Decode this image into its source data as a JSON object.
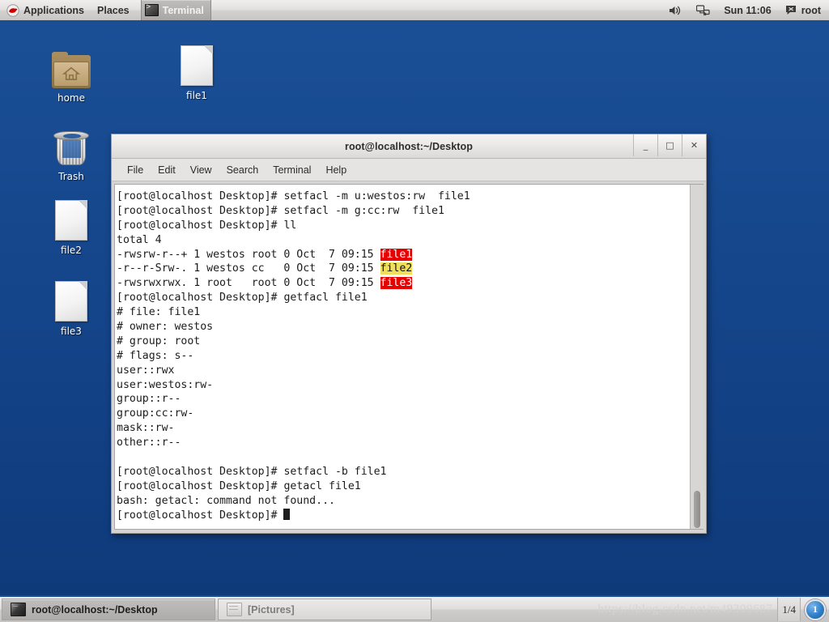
{
  "top_panel": {
    "applications_label": "Applications",
    "places_label": "Places",
    "window_tab_label": "Terminal",
    "clock": "Sun 11:06",
    "user": "root",
    "volume_icon": "volume-icon",
    "network_icon": "network-disconnected-icon",
    "logo_icon": "redhat-logo-icon"
  },
  "desktop": {
    "icons": [
      {
        "label": "home",
        "type": "folder",
        "name": "desktop-icon-home"
      },
      {
        "label": "file1",
        "type": "file",
        "name": "desktop-icon-file1"
      },
      {
        "label": "Trash",
        "type": "trash",
        "name": "desktop-icon-trash"
      },
      {
        "label": "file2",
        "type": "file",
        "name": "desktop-icon-file2"
      },
      {
        "label": "file3",
        "type": "file",
        "name": "desktop-icon-file3"
      }
    ]
  },
  "terminal": {
    "title": "root@localhost:~/Desktop",
    "window_buttons": {
      "minimize": "_",
      "maximize": "□",
      "close": "✕"
    },
    "menus": [
      "File",
      "Edit",
      "View",
      "Search",
      "Terminal",
      "Help"
    ],
    "prompt": "[root@localhost Desktop]# ",
    "lines": [
      {
        "prompt": "[root@localhost Desktop]# ",
        "text": "setfacl -m u:westos:rw  file1"
      },
      {
        "prompt": "[root@localhost Desktop]# ",
        "text": "setfacl -m g:cc:rw  file1"
      },
      {
        "prompt": "[root@localhost Desktop]# ",
        "text": "ll"
      },
      {
        "text": "total 4"
      },
      {
        "text": "-rwsrw-r--+ 1 westos root 0 Oct  7 09:15 ",
        "hl": "file1",
        "hl_style": "red"
      },
      {
        "text": "-r--r-Srw-. 1 westos cc   0 Oct  7 09:15 ",
        "hl": "file2",
        "hl_style": "yellow"
      },
      {
        "text": "-rwsrwxrwx. 1 root   root 0 Oct  7 09:15 ",
        "hl": "file3",
        "hl_style": "red"
      },
      {
        "prompt": "[root@localhost Desktop]# ",
        "text": "getfacl file1"
      },
      {
        "text": "# file: file1"
      },
      {
        "text": "# owner: westos"
      },
      {
        "text": "# group: root"
      },
      {
        "text": "# flags: s--"
      },
      {
        "text": "user::rwx"
      },
      {
        "text": "user:westos:rw-"
      },
      {
        "text": "group::r--"
      },
      {
        "text": "group:cc:rw-"
      },
      {
        "text": "mask::rw-"
      },
      {
        "text": "other::r--"
      },
      {
        "text": ""
      },
      {
        "prompt": "[root@localhost Desktop]# ",
        "text": "setfacl -b file1"
      },
      {
        "prompt": "[root@localhost Desktop]# ",
        "text": "getacl file1"
      },
      {
        "text": "bash: getacl: command not found..."
      },
      {
        "prompt": "[root@localhost Desktop]# ",
        "text": "",
        "cursor": true
      }
    ],
    "colors": {
      "highlight_red_bg": "#e60000",
      "highlight_red_fg": "#ffffff",
      "highlight_yellow_bg": "#f0df5a",
      "highlight_yellow_fg": "#101010",
      "background": "#ffffff",
      "foreground": "#1c1c1c"
    }
  },
  "taskbar": {
    "tasks": [
      {
        "label": "root@localhost:~/Desktop",
        "active": true,
        "icon": "terminal-icon"
      },
      {
        "label": "[Pictures]",
        "active": false,
        "icon": "drawer-icon"
      }
    ],
    "watermark": "https://blog.csdn.net/m49309687",
    "workspace": "1/4",
    "notification_count": "1"
  }
}
